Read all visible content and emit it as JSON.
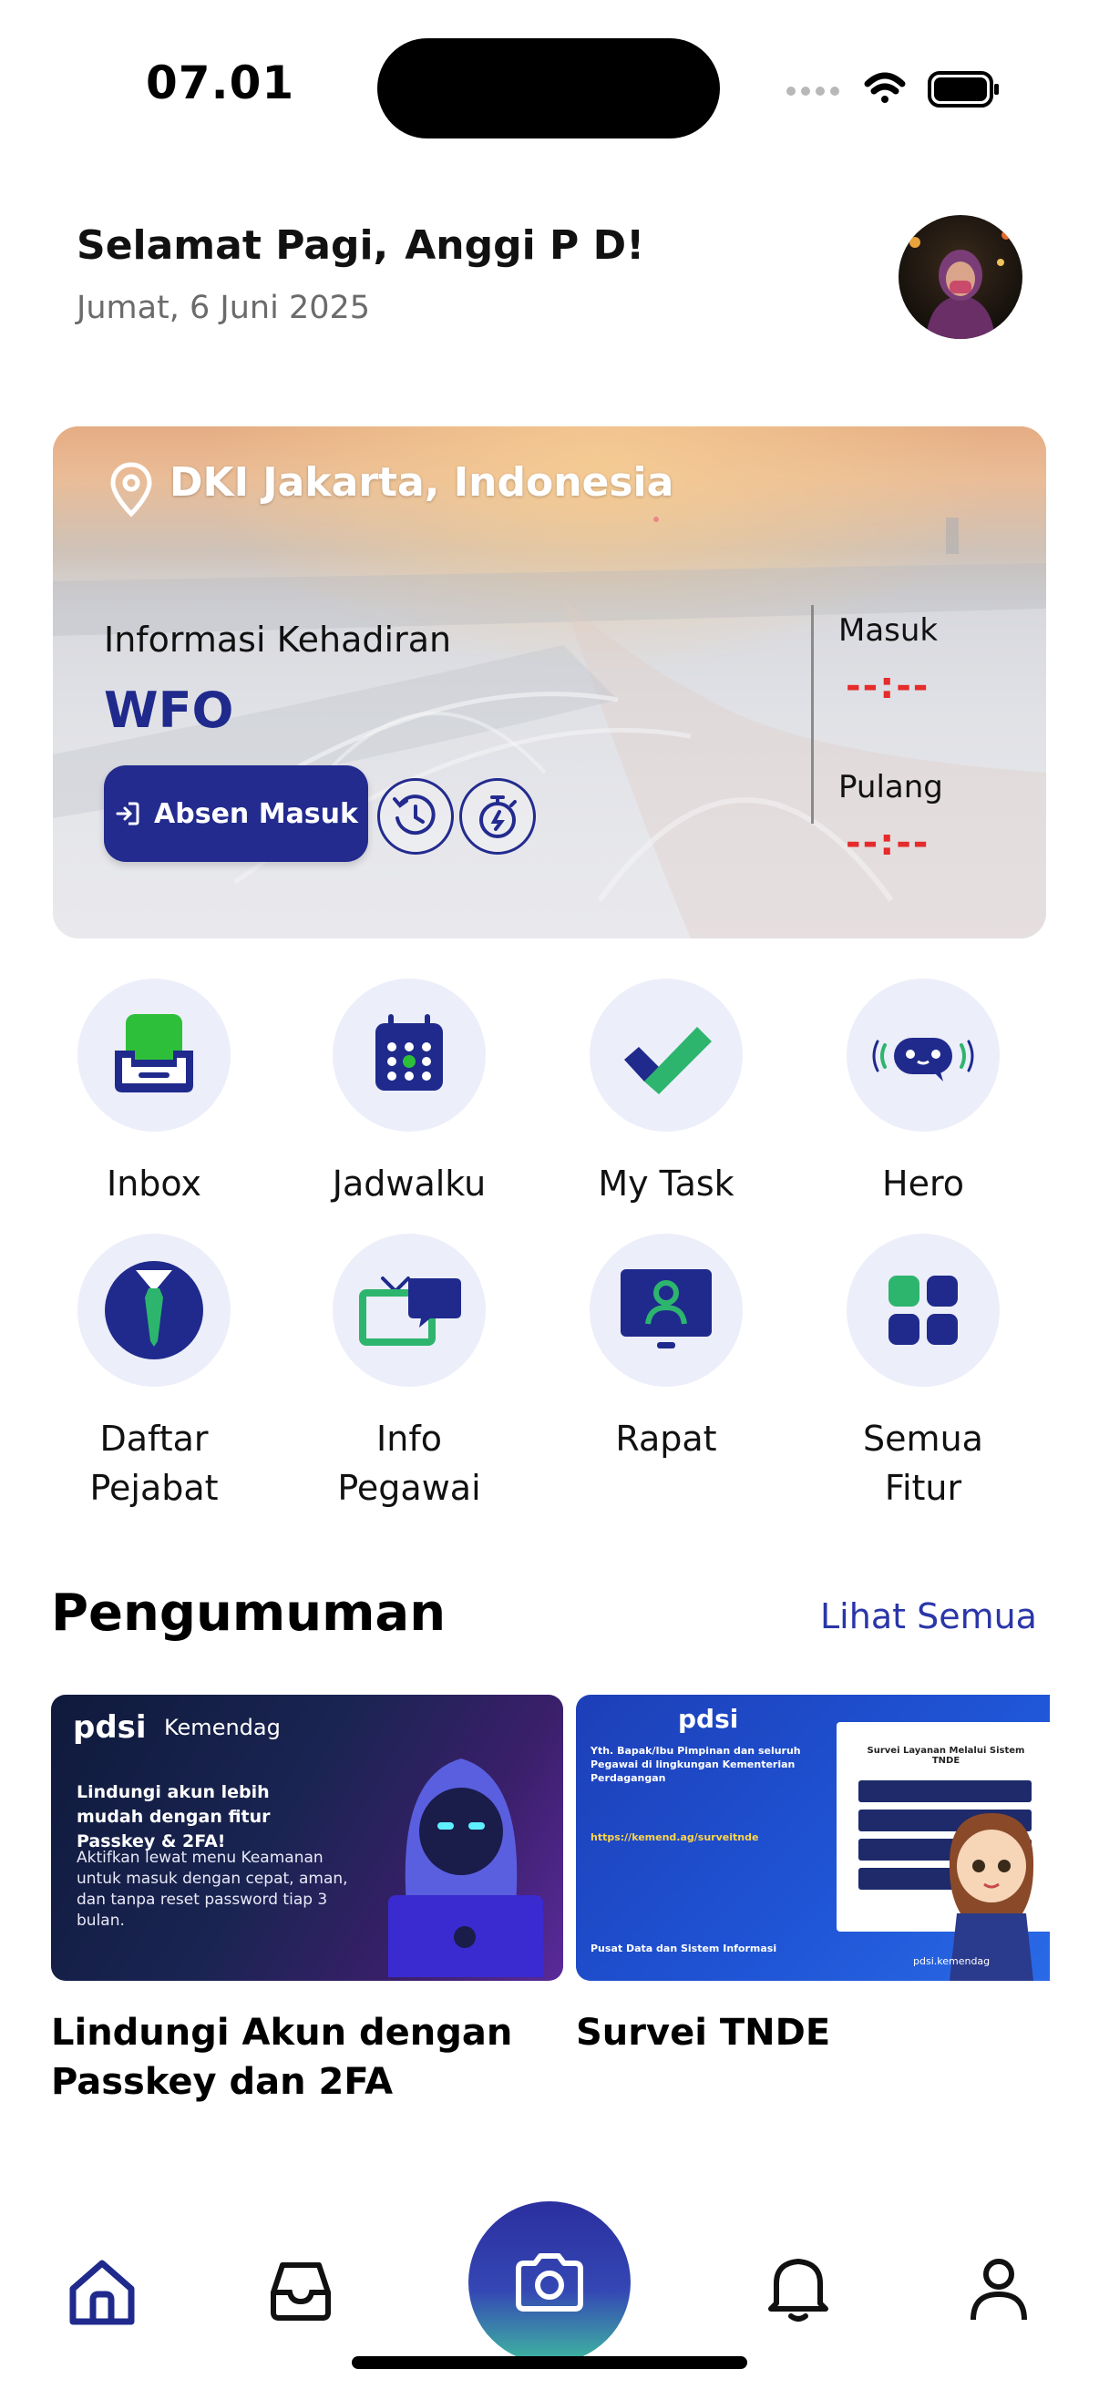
{
  "status_bar": {
    "time": "07.01"
  },
  "header": {
    "greeting": "Selamat Pagi,",
    "user_name": "Anggi P D!",
    "date": "Jumat, 6 Juni 2025"
  },
  "attendance": {
    "location": "DKI Jakarta, Indonesia",
    "info_label": "Informasi Kehadiran",
    "mode": "WFO",
    "checkin_button": "Absen Masuk",
    "masuk_label": "Masuk",
    "masuk_value": "--:--",
    "pulang_label": "Pulang",
    "pulang_value": "--:--"
  },
  "menu": [
    {
      "label": "Inbox",
      "icon": "inbox-icon"
    },
    {
      "label": "Jadwalku",
      "icon": "calendar-icon"
    },
    {
      "label": "My Task",
      "icon": "check-icon"
    },
    {
      "label": "Hero",
      "icon": "bot-icon"
    },
    {
      "label": "Daftar\nPejabat",
      "icon": "officer-icon"
    },
    {
      "label": "Info\nPegawai",
      "icon": "tv-chat-icon"
    },
    {
      "label": "Rapat",
      "icon": "monitor-user-icon"
    },
    {
      "label": "Semua\nFitur",
      "icon": "grid-icon"
    }
  ],
  "announcements": {
    "title": "Pengumuman",
    "see_all": "Lihat Semua",
    "items": [
      {
        "caption": "Lindungi Akun dengan Passkey dan 2FA",
        "brand_left": "pdsi",
        "brand_right": "Kemendag",
        "headline": "Lindungi akun lebih mudah dengan fitur Passkey & 2FA!",
        "body": "Aktifkan lewat menu Keamanan untuk masuk dengan cepat, aman, dan tanpa reset password tiap 3 bulan."
      },
      {
        "caption": "Survei TNDE",
        "brand": "pdsi",
        "heading": "Yth. Bapak/Ibu Pimpinan dan seluruh Pegawai di lingkungan Kementerian Perdagangan",
        "link": "https://kemend.ag/surveitnde",
        "footer": "Pusat Data dan Sistem Informasi",
        "panel_title": "Survei Layanan Melalui Sistem TNDE",
        "tag": "pdsi.kemendag"
      }
    ]
  },
  "bottom_nav": [
    {
      "name": "home",
      "icon": "home-icon"
    },
    {
      "name": "inbox",
      "icon": "tray-icon"
    },
    {
      "name": "camera",
      "icon": "camera-icon"
    },
    {
      "name": "notifications",
      "icon": "bell-icon"
    },
    {
      "name": "profile",
      "icon": "user-icon"
    }
  ],
  "colors": {
    "primary": "#232b8f",
    "accent_green": "#2db56e",
    "alert_red": "#e52b2b",
    "menu_bg": "#eceef9"
  }
}
